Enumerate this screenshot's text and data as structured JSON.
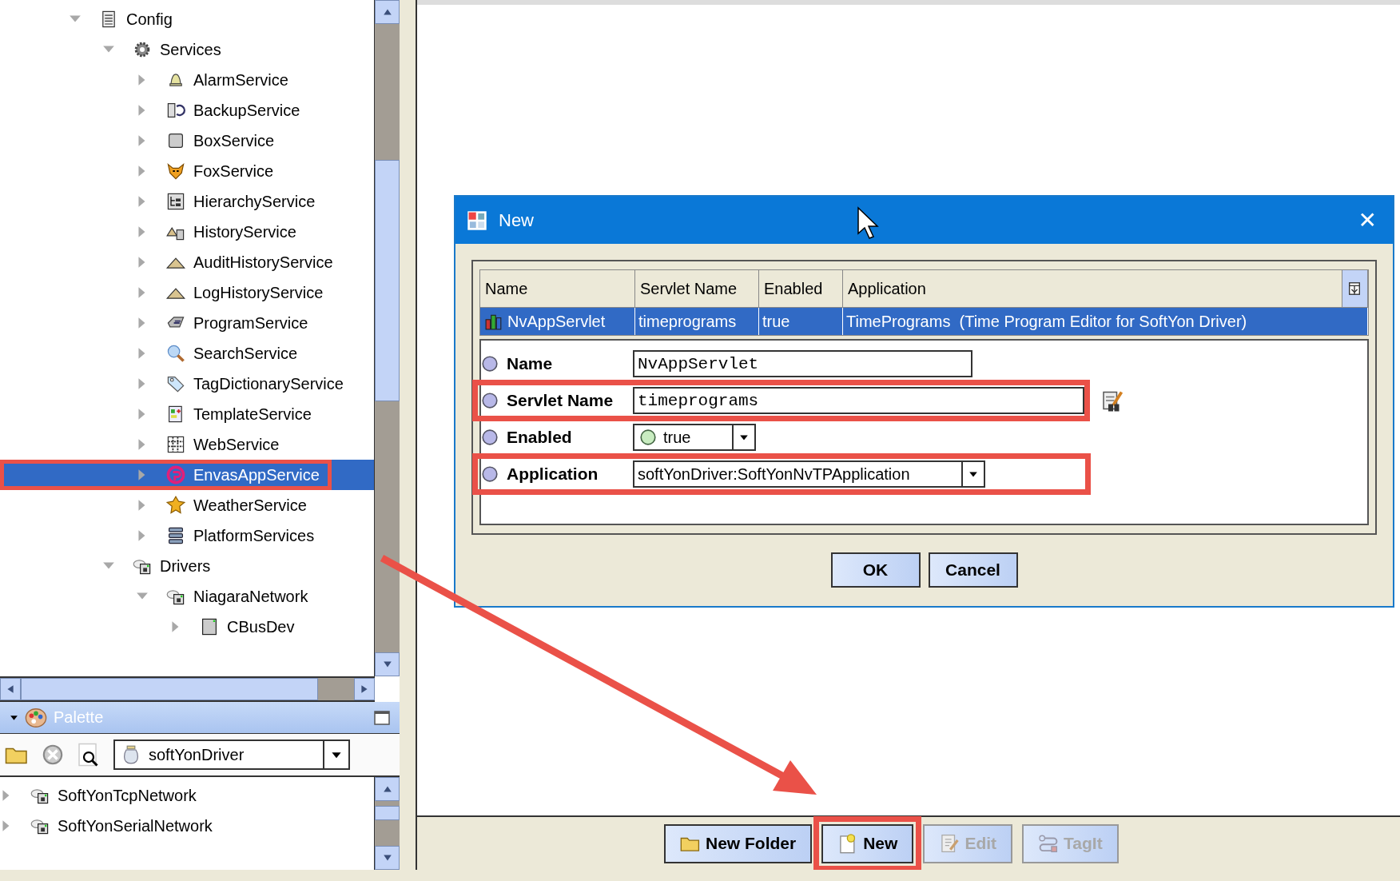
{
  "tree": [
    {
      "label": "Config",
      "expanded": true,
      "selected": false,
      "children": [
        {
          "label": "Services",
          "expanded": true,
          "selected": false,
          "children": [
            {
              "label": "AlarmService",
              "expanded": false,
              "selected": false
            },
            {
              "label": "BackupService",
              "expanded": false,
              "selected": false
            },
            {
              "label": "BoxService",
              "expanded": false,
              "selected": false
            },
            {
              "label": "FoxService",
              "expanded": false,
              "selected": false
            },
            {
              "label": "HierarchyService",
              "expanded": false,
              "selected": false
            },
            {
              "label": "HistoryService",
              "expanded": false,
              "selected": false
            },
            {
              "label": "AuditHistoryService",
              "expanded": false,
              "selected": false
            },
            {
              "label": "LogHistoryService",
              "expanded": false,
              "selected": false
            },
            {
              "label": "ProgramService",
              "expanded": false,
              "selected": false
            },
            {
              "label": "SearchService",
              "expanded": false,
              "selected": false
            },
            {
              "label": "TagDictionaryService",
              "expanded": false,
              "selected": false
            },
            {
              "label": "TemplateService",
              "expanded": false,
              "selected": false
            },
            {
              "label": "WebService",
              "expanded": false,
              "selected": false
            },
            {
              "label": "EnvasAppService",
              "expanded": false,
              "selected": true,
              "highlighted": true
            },
            {
              "label": "WeatherService",
              "expanded": false,
              "selected": false
            },
            {
              "label": "PlatformServices",
              "expanded": false,
              "selected": false
            }
          ]
        },
        {
          "label": "Drivers",
          "expanded": true,
          "selected": false,
          "children": [
            {
              "label": "NiagaraNetwork",
              "expanded": true,
              "selected": false,
              "children": [
                {
                  "label": "CBusDev",
                  "expanded": false,
                  "selected": false
                }
              ]
            }
          ]
        }
      ]
    }
  ],
  "palette": {
    "title": "Palette",
    "module": "softYonDriver",
    "items": [
      {
        "label": "SoftYonTcpNetwork",
        "expanded": false
      },
      {
        "label": "SoftYonSerialNetwork",
        "expanded": false
      }
    ]
  },
  "buttons": [
    {
      "label": "New Folder",
      "disabled": false,
      "highlighted": false
    },
    {
      "label": "New",
      "disabled": false,
      "highlighted": true
    },
    {
      "label": "Edit",
      "disabled": true,
      "highlighted": false
    },
    {
      "label": "TagIt",
      "disabled": true,
      "highlighted": false
    }
  ],
  "dialog": {
    "title": "New",
    "close": "✕",
    "table": {
      "columns": [
        "Name",
        "Servlet Name",
        "Enabled",
        "Application"
      ],
      "rows": [
        {
          "cells": [
            "NvAppServlet",
            "timeprograms",
            "true",
            "TimePrograms  (Time Program Editor for SoftYon Driver)"
          ],
          "selected": true
        }
      ]
    },
    "properties": [
      {
        "kind": "short-field",
        "label": "Name",
        "value": "NvAppServlet",
        "highlighted": false
      },
      {
        "kind": "picker-field",
        "label": "Servlet Name",
        "value": "timeprograms",
        "highlighted": true
      },
      {
        "kind": "bool-select",
        "label": "Enabled",
        "value": "true",
        "highlighted": false
      },
      {
        "kind": "select",
        "label": "Application",
        "value": "softYonDriver:SoftYonNvTPApplication",
        "highlighted": true
      }
    ],
    "buttons": [
      "OK",
      "Cancel"
    ]
  }
}
